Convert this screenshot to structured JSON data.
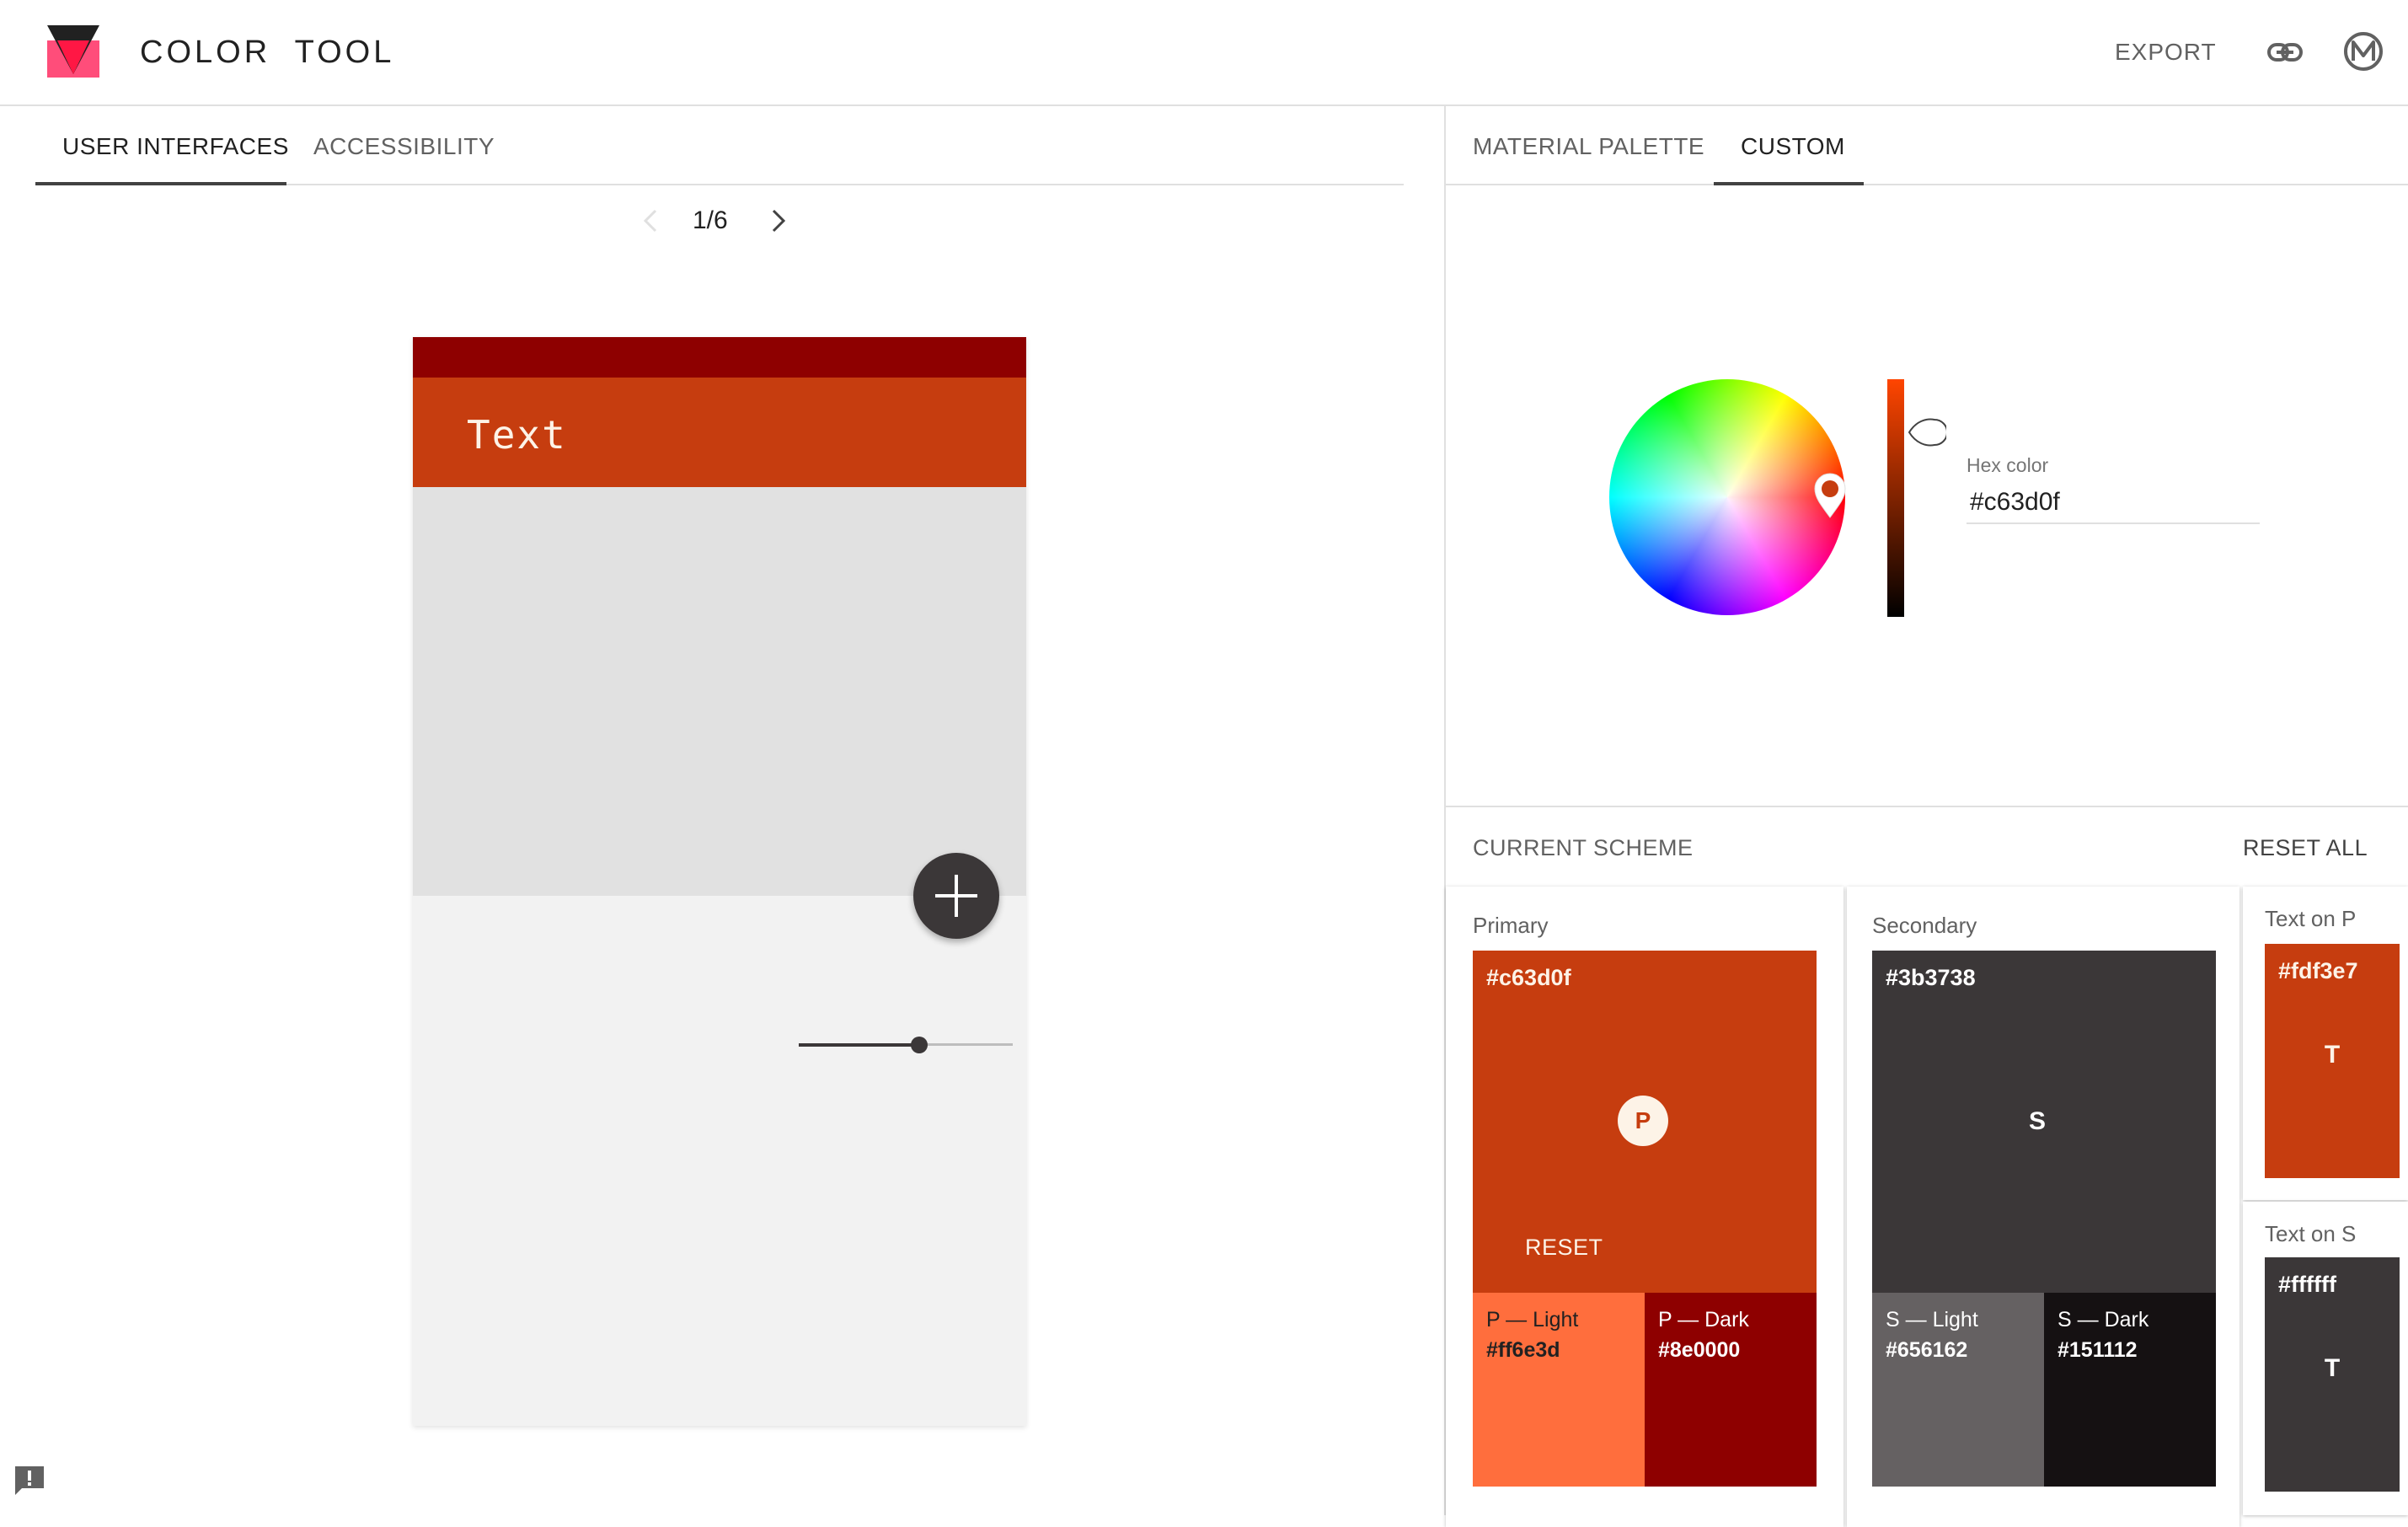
{
  "header": {
    "title": "COLOR  TOOL",
    "export_label": "EXPORT",
    "icons": [
      "color-tool-logo-icon",
      "link-icon",
      "material-logo-icon"
    ]
  },
  "left_panel": {
    "tabs": [
      {
        "label": "USER INTERFACES",
        "active": true
      },
      {
        "label": "ACCESSIBILITY",
        "active": false
      }
    ],
    "pager": {
      "label": "1/6"
    },
    "preview": {
      "appbar_text": "Text",
      "slider_value": 0.6
    }
  },
  "right_panel": {
    "tabs": [
      {
        "label": "MATERIAL PALETTE",
        "active": false
      },
      {
        "label": "CUSTOM",
        "active": true
      }
    ],
    "picker": {
      "hex_label": "Hex color",
      "hex_value": "#c63d0f"
    },
    "scheme": {
      "title": "CURRENT SCHEME",
      "reset_all_label": "RESET ALL",
      "primary": {
        "label": "Primary",
        "hex": "#c63d0f",
        "badge": "P",
        "reset_label": "RESET",
        "light": {
          "label": "P — Light",
          "hex": "#ff6e3d"
        },
        "dark": {
          "label": "P — Dark",
          "hex": "#8e0000"
        }
      },
      "secondary": {
        "label": "Secondary",
        "hex": "#3b3738",
        "badge": "S",
        "light": {
          "label": "S — Light",
          "hex": "#656162"
        },
        "dark": {
          "label": "S — Dark",
          "hex": "#151112"
        }
      },
      "text_on_p": {
        "label": "Text on P",
        "hex": "#fdf3e7",
        "glyph": "T"
      },
      "text_on_s": {
        "label": "Text on S",
        "hex": "#ffffff",
        "glyph": "T"
      }
    }
  },
  "colors": {
    "primary": "#c63d0f",
    "primary_light": "#ff6e3d",
    "primary_dark": "#8e0000",
    "secondary": "#3b3738",
    "secondary_light": "#656162",
    "secondary_dark": "#151112",
    "text_on_primary": "#fdf3e7",
    "text_on_secondary": "#ffffff"
  }
}
